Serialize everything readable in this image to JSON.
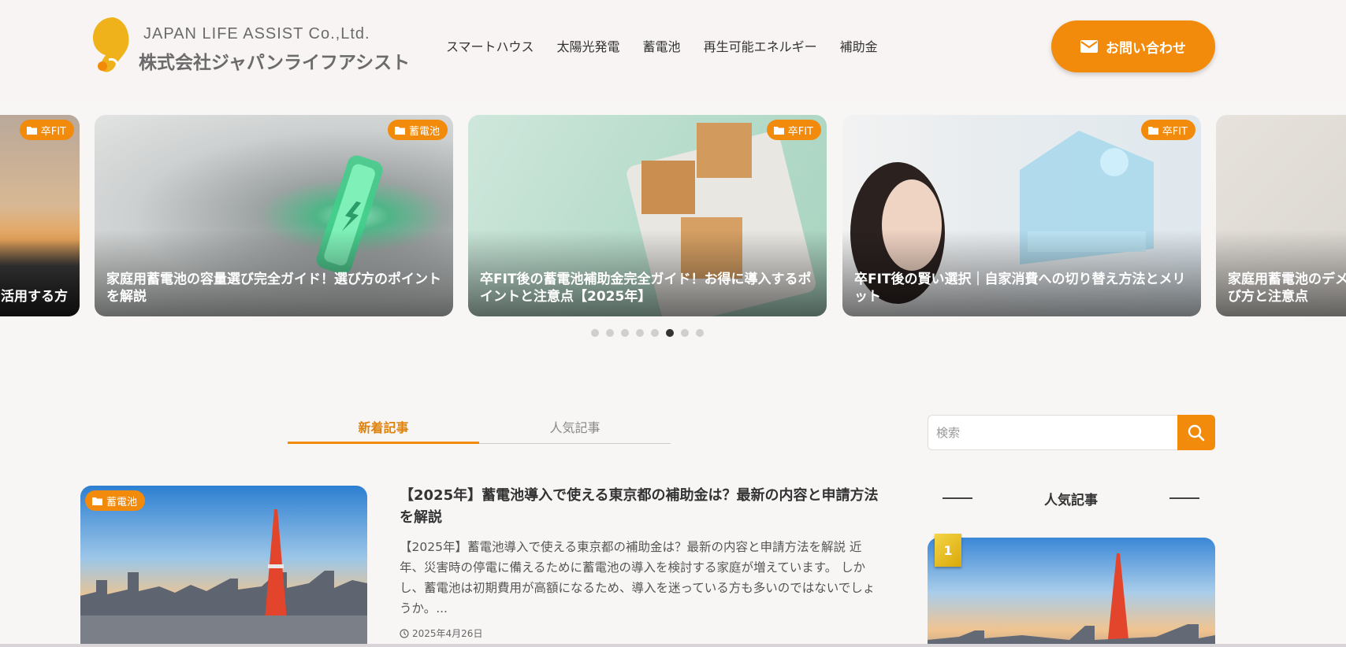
{
  "header": {
    "logo_en": "JAPAN LIFE ASSIST Co.,Ltd.",
    "logo_jp": "株式会社ジャパンライフアシスト",
    "nav": [
      "スマートハウス",
      "太陽光発電",
      "蓄電池",
      "再生可能エネルギー",
      "補助金"
    ],
    "contact_label": "お問い合わせ"
  },
  "slider": {
    "cards": [
      {
        "category": "卒FIT",
        "title": "活用する方"
      },
      {
        "category": "蓄電池",
        "title": "家庭用蓄電池の容量選び完全ガイド！選び方のポイントを解説"
      },
      {
        "category": "卒FIT",
        "title": "卒FIT後の蓄電池補助金完全ガイド！お得に導入するポイントと注意点【2025年】"
      },
      {
        "category": "卒FIT",
        "title": "卒FIT後の賢い選択｜自家消費への切り替え方法とメリット"
      },
      {
        "category": "",
        "title": "家庭用蓄電池のデメ選び方と注意点"
      }
    ],
    "pagination": {
      "total": 8,
      "active": 5
    }
  },
  "tabs": [
    {
      "label": "新着記事",
      "active": true
    },
    {
      "label": "人気記事",
      "active": false
    }
  ],
  "article": {
    "category": "蓄電池",
    "title": "【2025年】蓄電池導入で使える東京都の補助金は？最新の内容と申請方法を解説",
    "excerpt": "【2025年】蓄電池導入で使える東京都の補助金は？最新の内容と申請方法を解説 近年、災害時の停電に備えるために蓄電池の導入を検討する家庭が増えています。 しかし、蓄電池は初期費用が高額になるため、導入を迷っている方も多いのではないでしょうか。...",
    "date": "2025年4月26日"
  },
  "sidebar": {
    "search_placeholder": "検索",
    "popular_heading": "人気記事",
    "rank": "1"
  },
  "colors": {
    "accent": "#f28a0c",
    "text": "#333333",
    "background": "#f8f6f5"
  }
}
